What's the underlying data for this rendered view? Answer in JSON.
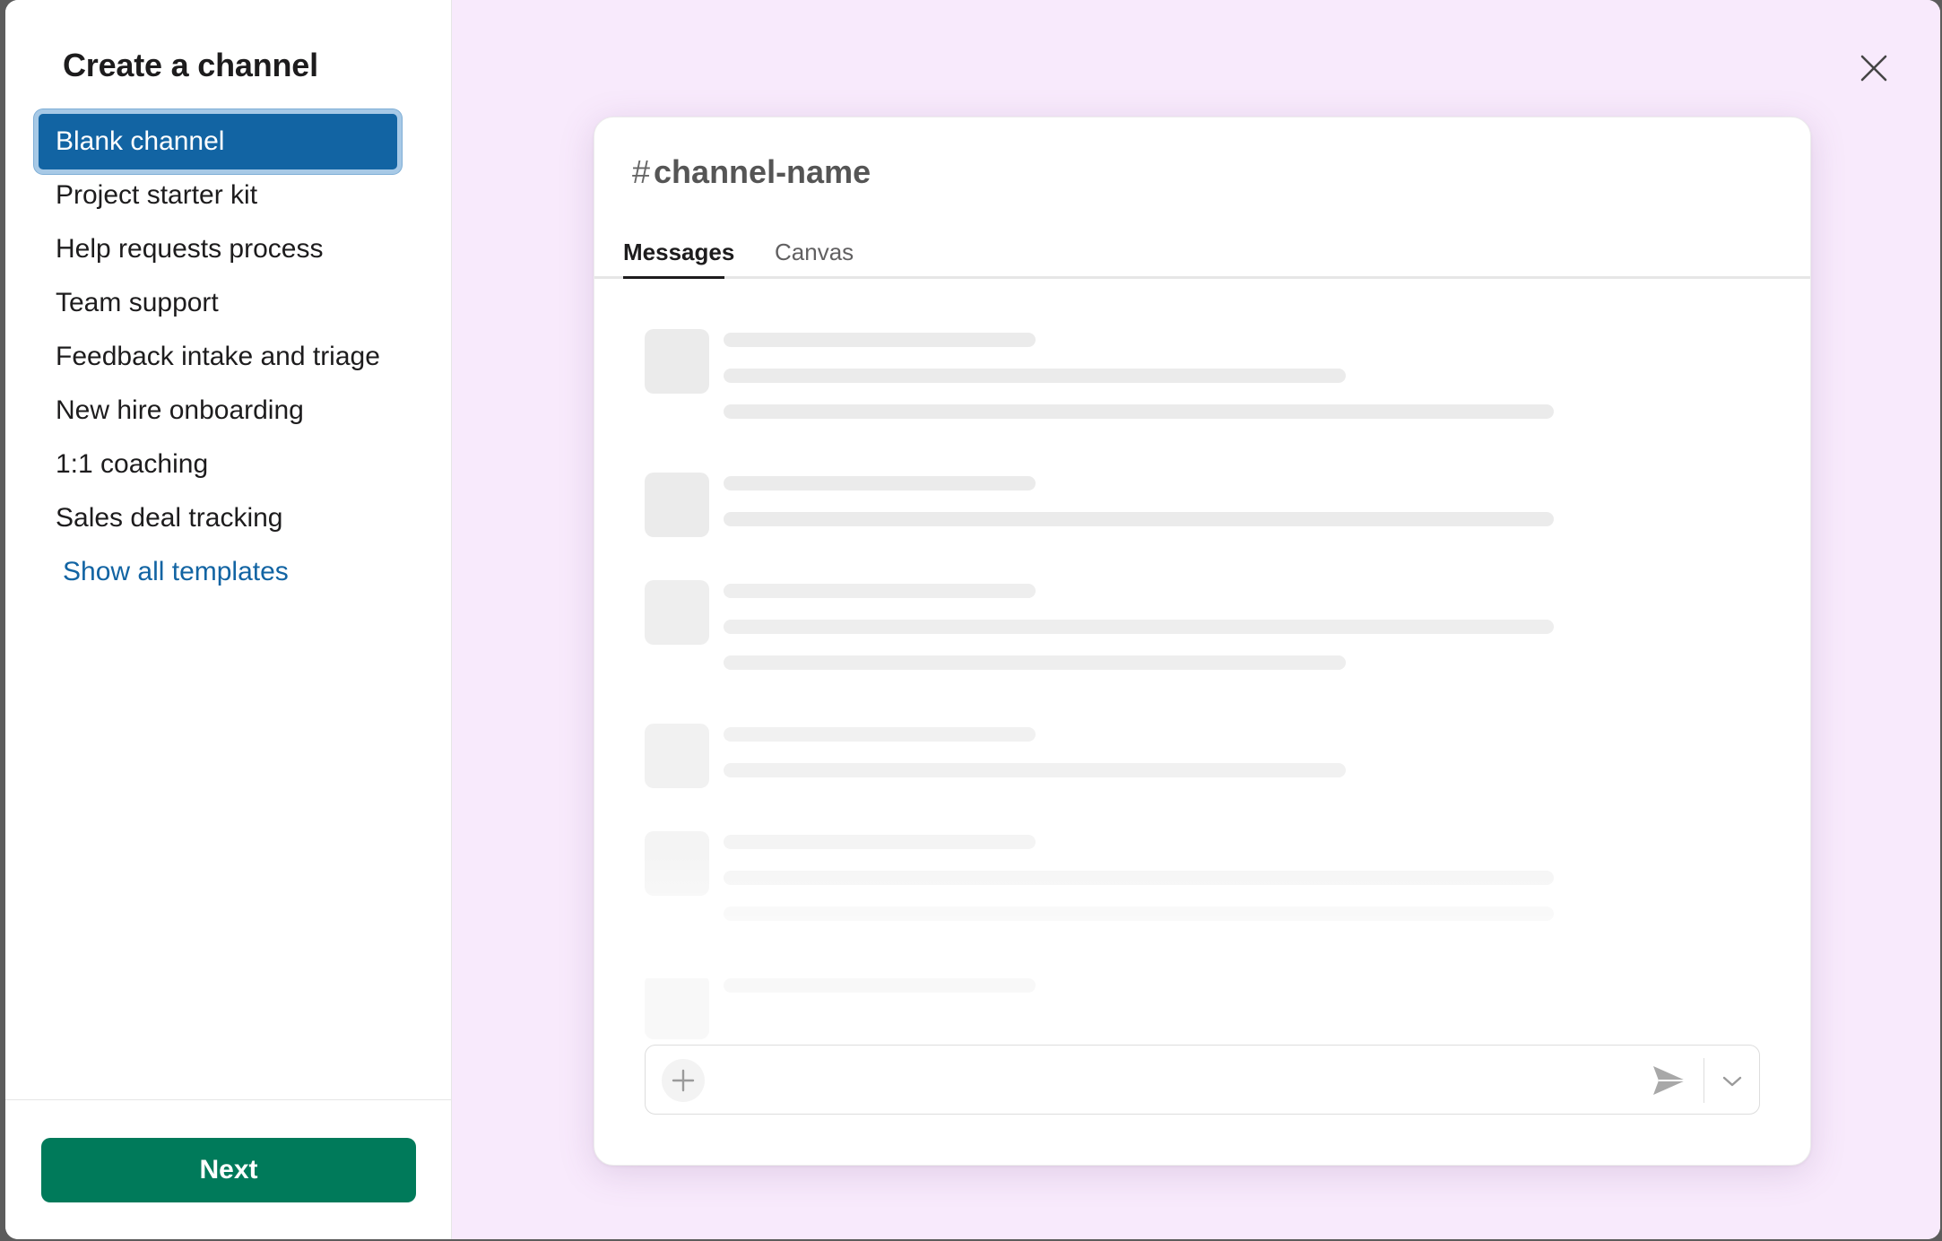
{
  "left_panel": {
    "title": "Create a channel",
    "templates": [
      {
        "label": "Blank channel",
        "selected": true
      },
      {
        "label": "Project starter kit",
        "selected": false
      },
      {
        "label": "Help requests process",
        "selected": false
      },
      {
        "label": "Team support",
        "selected": false
      },
      {
        "label": "Feedback intake and triage",
        "selected": false
      },
      {
        "label": "New hire onboarding",
        "selected": false
      },
      {
        "label": "1:1 coaching",
        "selected": false
      },
      {
        "label": "Sales deal tracking",
        "selected": false
      }
    ],
    "show_all_label": "Show all templates",
    "next_label": "Next"
  },
  "preview": {
    "hash": "#",
    "channel_name": "channel-name",
    "tabs": [
      {
        "label": "Messages",
        "active": true
      },
      {
        "label": "Canvas",
        "active": false
      }
    ]
  },
  "icons": {
    "close": "close-icon",
    "plus": "plus-icon",
    "send": "send-icon",
    "chevron": "chevron-down-icon"
  },
  "colors": {
    "selected_bg": "#1264a3",
    "link": "#1264a3",
    "primary_button": "#007a5a",
    "preview_bg": "#f8eafc"
  }
}
